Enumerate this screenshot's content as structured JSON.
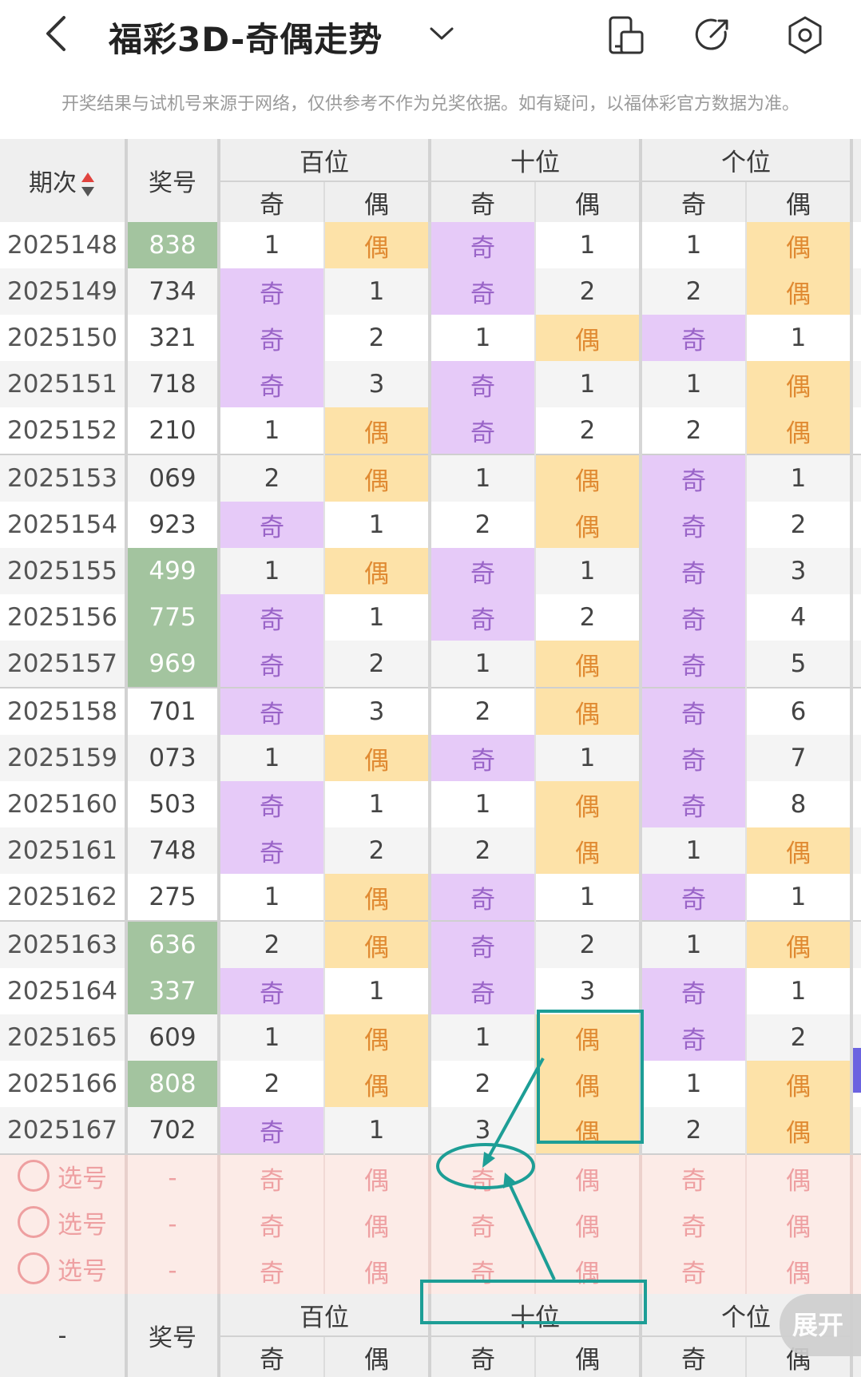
{
  "header": {
    "title": "福彩3D-奇偶走势"
  },
  "notice": "开奖结果与试机号来源于网络，仅供参考不作为兑奖依据。如有疑问，以福体彩官方数据为准。",
  "table": {
    "col_issue": "期次",
    "col_number": "奖号",
    "groups": [
      "百位",
      "十位",
      "个位"
    ],
    "sub_odd": "奇",
    "sub_even": "偶",
    "rows": [
      {
        "issue": "2025148",
        "num": "838",
        "green": true,
        "cells": [
          "1",
          "偶",
          "奇",
          "1",
          "1",
          "偶"
        ]
      },
      {
        "issue": "2025149",
        "num": "734",
        "green": false,
        "cells": [
          "奇",
          "1",
          "奇",
          "2",
          "2",
          "偶"
        ]
      },
      {
        "issue": "2025150",
        "num": "321",
        "green": false,
        "cells": [
          "奇",
          "2",
          "1",
          "偶",
          "奇",
          "1"
        ]
      },
      {
        "issue": "2025151",
        "num": "718",
        "green": false,
        "cells": [
          "奇",
          "3",
          "奇",
          "1",
          "1",
          "偶"
        ]
      },
      {
        "issue": "2025152",
        "num": "210",
        "green": false,
        "cells": [
          "1",
          "偶",
          "奇",
          "2",
          "2",
          "偶"
        ]
      },
      {
        "issue": "2025153",
        "num": "069",
        "green": false,
        "cells": [
          "2",
          "偶",
          "1",
          "偶",
          "奇",
          "1"
        ]
      },
      {
        "issue": "2025154",
        "num": "923",
        "green": false,
        "cells": [
          "奇",
          "1",
          "2",
          "偶",
          "奇",
          "2"
        ]
      },
      {
        "issue": "2025155",
        "num": "499",
        "green": true,
        "cells": [
          "1",
          "偶",
          "奇",
          "1",
          "奇",
          "3"
        ]
      },
      {
        "issue": "2025156",
        "num": "775",
        "green": true,
        "cells": [
          "奇",
          "1",
          "奇",
          "2",
          "奇",
          "4"
        ]
      },
      {
        "issue": "2025157",
        "num": "969",
        "green": true,
        "cells": [
          "奇",
          "2",
          "1",
          "偶",
          "奇",
          "5"
        ]
      },
      {
        "issue": "2025158",
        "num": "701",
        "green": false,
        "cells": [
          "奇",
          "3",
          "2",
          "偶",
          "奇",
          "6"
        ]
      },
      {
        "issue": "2025159",
        "num": "073",
        "green": false,
        "cells": [
          "1",
          "偶",
          "奇",
          "1",
          "奇",
          "7"
        ]
      },
      {
        "issue": "2025160",
        "num": "503",
        "green": false,
        "cells": [
          "奇",
          "1",
          "1",
          "偶",
          "奇",
          "8"
        ]
      },
      {
        "issue": "2025161",
        "num": "748",
        "green": false,
        "cells": [
          "奇",
          "2",
          "2",
          "偶",
          "1",
          "偶"
        ]
      },
      {
        "issue": "2025162",
        "num": "275",
        "green": false,
        "cells": [
          "1",
          "偶",
          "奇",
          "1",
          "奇",
          "1"
        ]
      },
      {
        "issue": "2025163",
        "num": "636",
        "green": true,
        "cells": [
          "2",
          "偶",
          "奇",
          "2",
          "1",
          "偶"
        ]
      },
      {
        "issue": "2025164",
        "num": "337",
        "green": true,
        "cells": [
          "奇",
          "1",
          "奇",
          "3",
          "奇",
          "1"
        ]
      },
      {
        "issue": "2025165",
        "num": "609",
        "green": false,
        "cells": [
          "1",
          "偶",
          "1",
          "偶",
          "奇",
          "2"
        ]
      },
      {
        "issue": "2025166",
        "num": "808",
        "green": true,
        "cells": [
          "2",
          "偶",
          "2",
          "偶",
          "1",
          "偶"
        ]
      },
      {
        "issue": "2025167",
        "num": "702",
        "green": false,
        "cells": [
          "奇",
          "1",
          "3",
          "偶",
          "2",
          "偶"
        ]
      }
    ],
    "select_label": "选号",
    "select_dash": "-",
    "footer_dash": "-"
  },
  "expand_label": "展开",
  "colors": {
    "odd_bg": "#e6caf8",
    "even_bg": "#fde2a8",
    "green_bg": "#a3c49f",
    "annotation": "#1d9e96"
  },
  "icons": [
    "back-arrow-icon",
    "chevron-down-icon",
    "device-icon",
    "share-icon",
    "settings-hex-icon"
  ]
}
